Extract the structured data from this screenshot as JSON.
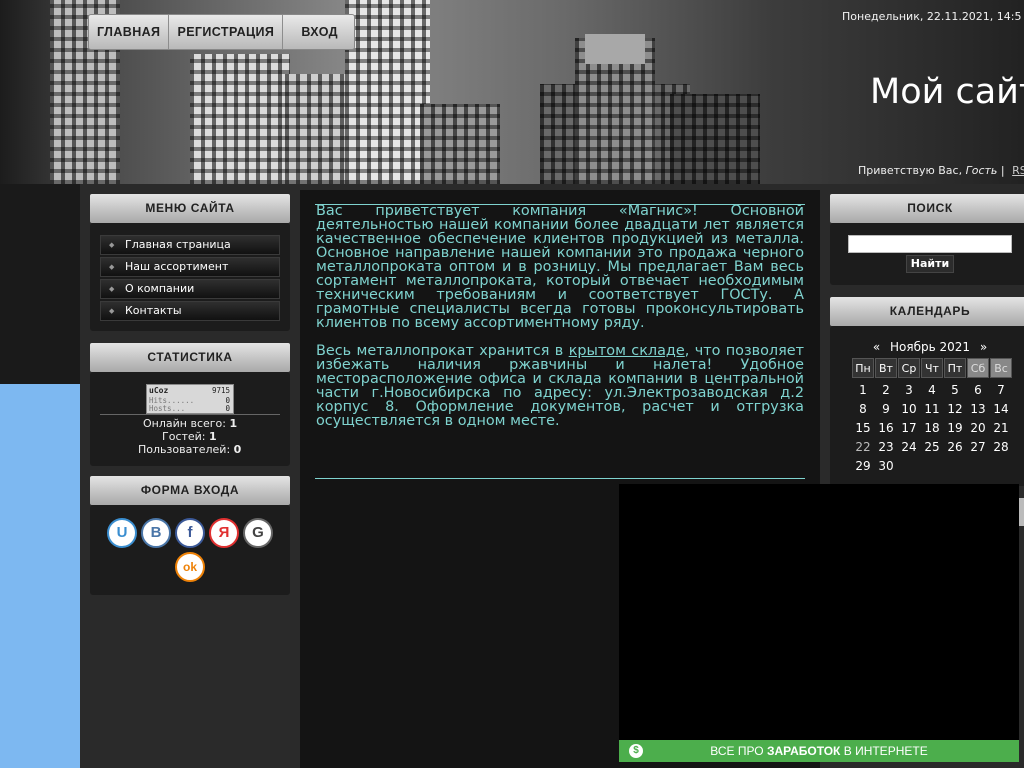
{
  "nav": {
    "home": "ГЛАВНАЯ",
    "register": "РЕГИСТРАЦИЯ",
    "login": "ВХОД"
  },
  "header": {
    "datetime": "Понедельник, 22.11.2021, 14:5",
    "site_title": "Мой сайт",
    "greeting_prefix": "Приветствую Вас,",
    "greeting_user": "Гость",
    "rss": "RS"
  },
  "sidebar_left": {
    "menu_title": "МЕНЮ САЙТА",
    "menu_items": [
      "Главная страница",
      "Наш ассортимент",
      "О компании",
      "Контакты"
    ],
    "stats_title": "СТАТИСТИКА",
    "counter": {
      "brand": "uCoz",
      "hits_total": "9715",
      "hits_label": "Hits......",
      "hits_value": "0",
      "hosts_label": "Hosts...",
      "hosts_value": "0"
    },
    "stats": {
      "online_label": "Онлайн всего:",
      "online_value": "1",
      "guests_label": "Гостей:",
      "guests_value": "1",
      "users_label": "Пользователей:",
      "users_value": "0"
    },
    "login_title": "ФОРМА ВХОДА",
    "social": [
      {
        "icon": "ucoz-icon",
        "glyph": "U",
        "color": "#3a8ed0"
      },
      {
        "icon": "vk-icon",
        "glyph": "B",
        "color": "#4a76a8"
      },
      {
        "icon": "facebook-icon",
        "glyph": "f",
        "color": "#3b5998"
      },
      {
        "icon": "yandex-icon",
        "glyph": "Я",
        "color": "#e03030"
      },
      {
        "icon": "google-icon",
        "glyph": "G",
        "color": "#444444"
      },
      {
        "icon": "odnoklassniki-icon",
        "glyph": "ok",
        "color": "#ee8208"
      }
    ]
  },
  "content": {
    "paragraph1": "Вас приветствует компания «Магнис»! Основной деятельностью нашей компании более двадцати лет является качественное обеспечение клиентов продукцией из металла. Основное направление нашей компании это продажа черного металлопроката оптом и в розницу. Мы предлагает Вам весь сортамент металлопроката, который отвечает необходимым техническим требованиям и соответствует ГОСТу. А грамотные специалисты всегда готовы проконсультировать клиентов по всему ассортиментному ряду.",
    "paragraph2_before": "Весь металлопрокат хранится в ",
    "paragraph2_link": "крытом складе",
    "paragraph2_after": ", что позволяет избежать наличия ржавчины и налета! Удобное месторасположение офиса и склада компании в центральной части г.Новосибирска по адресу: ул.Электрозаводская д.2 корпус 8. Оформление документов, расчет и отгрузка осуществляется в одном месте."
  },
  "sidebar_right": {
    "search_title": "ПОИСК",
    "search_value": "",
    "search_button": "Найти",
    "calendar_title": "КАЛЕНДАРЬ",
    "calendar": {
      "prev": "«",
      "month": "Ноябрь 2021",
      "next": "»",
      "daynames": [
        "Пн",
        "Вт",
        "Ср",
        "Чт",
        "Пт",
        "Сб",
        "Вс"
      ],
      "weeks": [
        [
          "1",
          "2",
          "3",
          "4",
          "5",
          "6",
          "7"
        ],
        [
          "8",
          "9",
          "10",
          "11",
          "12",
          "13",
          "14"
        ],
        [
          "15",
          "16",
          "17",
          "18",
          "19",
          "20",
          "21"
        ],
        [
          "22",
          "23",
          "24",
          "25",
          "26",
          "27",
          "28"
        ],
        [
          "29",
          "30",
          "",
          "",
          "",
          "",
          ""
        ]
      ],
      "today": "22"
    }
  },
  "ad": {
    "text_before": "ВСЕ ПРО ",
    "text_bold": "ЗАРАБОТОК",
    "text_after": " В ИНТЕРНЕТЕ",
    "icon_glyph": "$"
  }
}
